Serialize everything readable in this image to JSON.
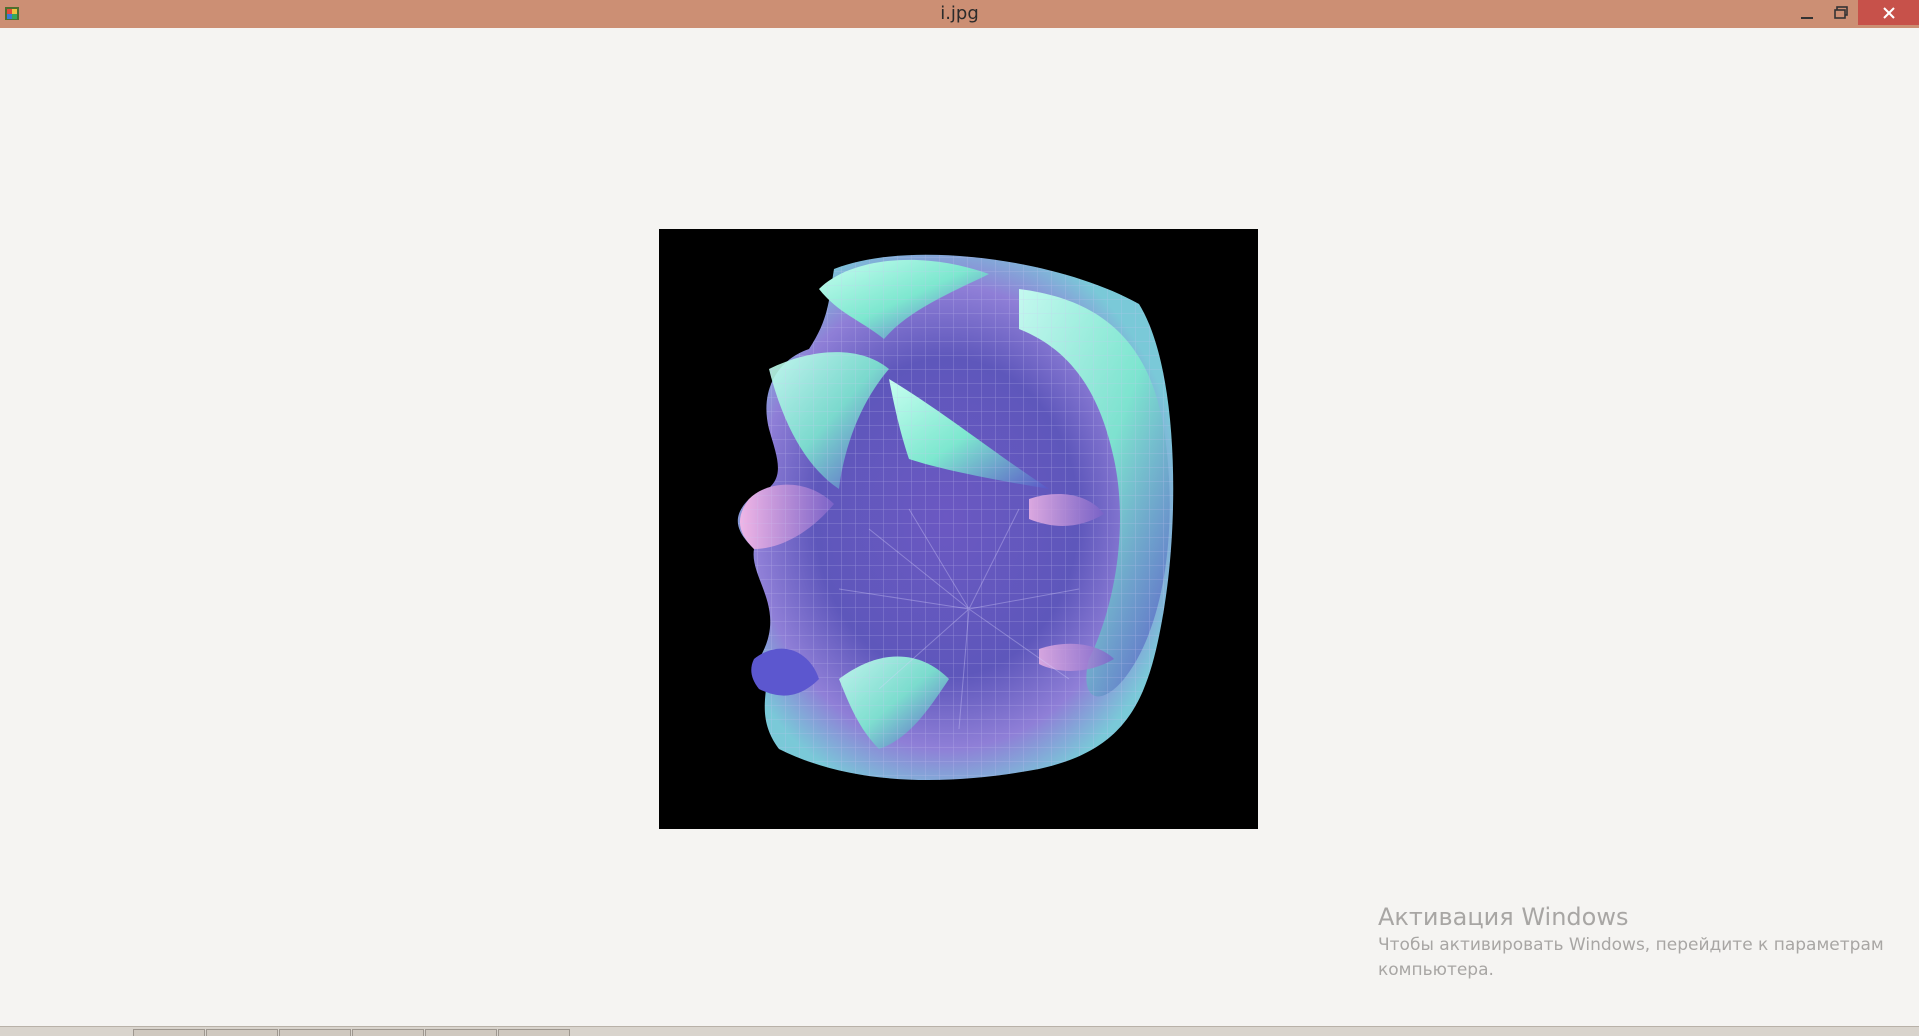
{
  "window": {
    "title": "i.jpg"
  },
  "title_controls": {
    "minimize_icon": "minimize-icon",
    "maximize_icon": "restore-icon",
    "close_icon": "close-icon"
  },
  "colors": {
    "titlebar": "#cc8f74",
    "close_button": "#c7514a",
    "background": "#f5f4f2",
    "image_background": "#000000",
    "surface_mint": "#8ff0d8",
    "surface_violet": "#5f55c4",
    "surface_pink": "#d79bd6"
  },
  "activation_notice": {
    "title": "Активация Windows",
    "line1": "Чтобы активировать Windows, перейдите к параметрам",
    "line2": "компьютера."
  }
}
